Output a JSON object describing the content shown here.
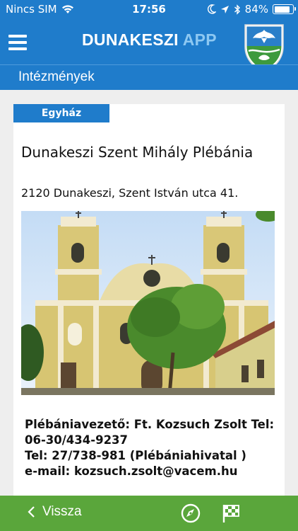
{
  "status_bar": {
    "carrier": "Nincs SIM",
    "time": "17:56",
    "battery_text": "84%",
    "battery_level": 0.84
  },
  "header": {
    "title_main": "DUNAKESZI",
    "title_accent": "APP"
  },
  "section": {
    "title": "Intézmények"
  },
  "card": {
    "category": "Egyház",
    "name": "Dunakeszi Szent Mihály Plébánia",
    "address": "2120 Dunakeszi, Szent István utca 41.",
    "details": [
      "Plébániavezető: Ft. Kozsuch Zsolt  Tel:",
      "06-30/434-9237",
      " Tel:  27/738-981 (Plébániahivatal )",
      " e-mail: kozsuch.zsolt@vacem.hu"
    ]
  },
  "bottom_bar": {
    "back_label": "Vissza",
    "back_icon": "chevron-left-icon",
    "compass_icon": "compass-icon",
    "flag_icon": "checkered-flag-icon"
  },
  "colors": {
    "primary": "#1f7ccb",
    "accent_text": "#8dc8f2",
    "bottom_bar": "#5aa63b"
  }
}
